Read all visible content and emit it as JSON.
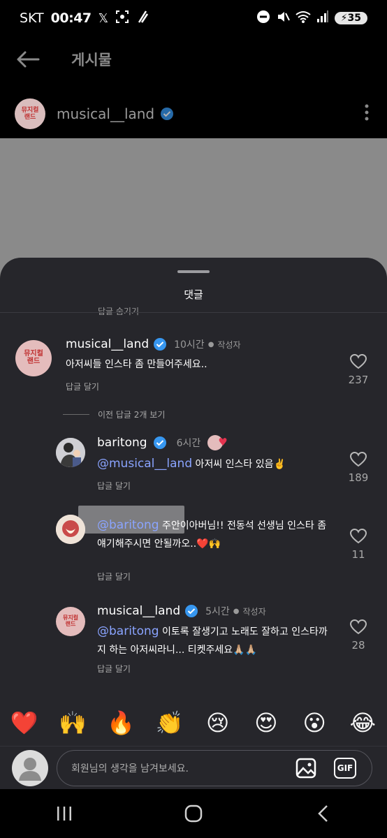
{
  "status": {
    "carrier": "SKT",
    "time": "00:47",
    "battery": "35"
  },
  "header": {
    "title": "게시물"
  },
  "post": {
    "username": "musical__land",
    "avatar_text_top": "뮤지컬",
    "avatar_text_bottom": "랜드"
  },
  "sheet": {
    "title": "댓글",
    "cut_text": "답글 숨기기",
    "view_previous": "이전 답글 2개 보기"
  },
  "comments": [
    {
      "username": "musical__land",
      "time": "10시간",
      "author_tag": "작성자",
      "text": "아저씨들 인스타 좀 만들어주세요..",
      "reply": "답글 달기",
      "likes": "237"
    },
    {
      "username": "baritong",
      "time": "6시간",
      "mention": "@musical__land",
      "text": " 아저씨 인스타 있음✌️",
      "reply": "답글 달기",
      "likes": "189"
    },
    {
      "mention": "@baritong",
      "text": " 주안이아버님!! 전동석 선생님 인스타 좀 얘기해주시면 안될까오..❤️🙌",
      "reply": "답글 달기",
      "likes": "11"
    },
    {
      "username": "musical__land",
      "time": "5시간",
      "author_tag": "작성자",
      "mention": "@baritong",
      "text": " 이토록 잘생기고 노래도 잘하고 인스타까지 하는 아저씨라니... 티켓주세요🙏🏼🙏🏼",
      "reply": "답글 달기",
      "likes": "28"
    }
  ],
  "emojis": [
    "❤️",
    "🙌",
    "🔥",
    "👏",
    "😢",
    "😍",
    "😮",
    "😂"
  ],
  "input": {
    "placeholder": "회원님의 생각을 남겨보세요.",
    "gif_label": "GIF"
  },
  "colors": {
    "sheet_bg": "#26262b",
    "mention": "#8aa4ff",
    "verified": "#3797f0"
  }
}
